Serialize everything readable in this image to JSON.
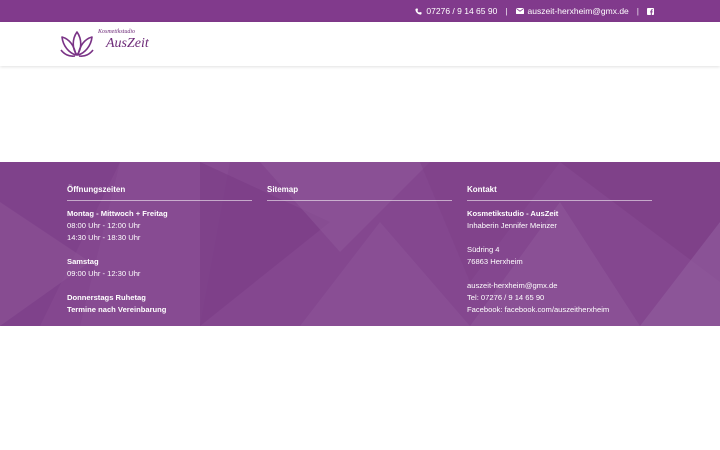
{
  "topbar": {
    "phone": "07276 / 9 14 65 90",
    "separator": "|",
    "email": "auszeit-herxheim@gmx.de",
    "facebook_icon": "facebook-icon",
    "phone_icon": "phone-icon",
    "mail_icon": "envelope-icon"
  },
  "header": {
    "logo": {
      "small_text": "Kosmetikstudio",
      "script_text": "AusZeit"
    }
  },
  "footer": {
    "hours": {
      "heading": "Öffnungszeiten",
      "weekday_label": "Montag - Mittwoch + Freitag",
      "weekday_morning": "08:00 Uhr - 12:00 Uhr",
      "weekday_afternoon": "14:30 Uhr - 18:30 Uhr",
      "saturday_label": "Samstag",
      "saturday_hours": "09:00 Uhr - 12:30 Uhr",
      "thursday_note": "Donnerstags Ruhetag",
      "appointment_note": "Termine nach Vereinbarung"
    },
    "sitemap": {
      "heading": "Sitemap"
    },
    "contact": {
      "heading": "Kontakt",
      "studio_name": "Kosmetikstudio - AusZeit",
      "owner": "Inhaberin Jennifer Meinzer",
      "street": "Südring 4",
      "city": "76863 Herxheim",
      "email": "auszeit-herxheim@gmx.de",
      "phone": "Tel: 07276 / 9 14 65 90",
      "facebook": "Facebook: facebook.com/auszeitherxheim"
    }
  },
  "colors": {
    "topbar": "#813a8c",
    "footer": "#84478f",
    "logo": "#6d2a78"
  }
}
